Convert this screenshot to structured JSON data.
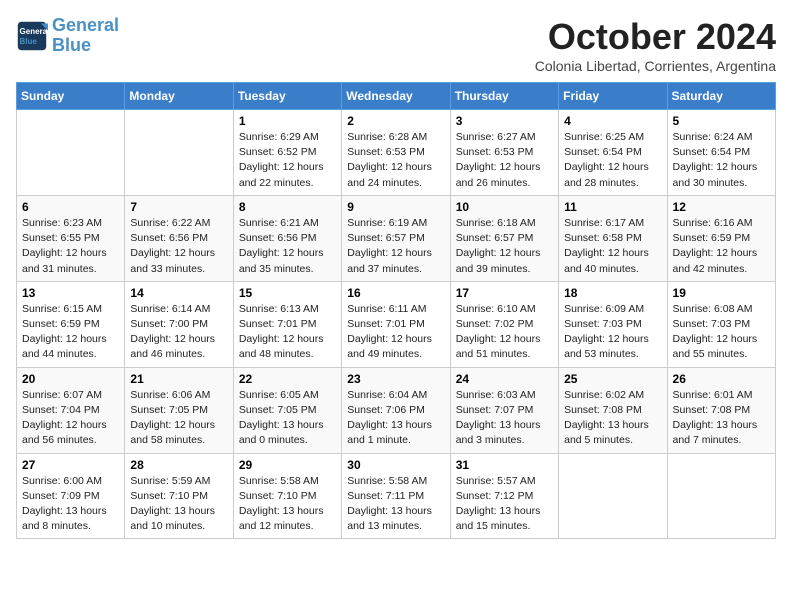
{
  "logo": {
    "line1": "General",
    "line2": "Blue"
  },
  "title": "October 2024",
  "subtitle": "Colonia Libertad, Corrientes, Argentina",
  "days_header": [
    "Sunday",
    "Monday",
    "Tuesday",
    "Wednesday",
    "Thursday",
    "Friday",
    "Saturday"
  ],
  "weeks": [
    [
      {
        "day": "",
        "info": ""
      },
      {
        "day": "",
        "info": ""
      },
      {
        "day": "1",
        "info": "Sunrise: 6:29 AM\nSunset: 6:52 PM\nDaylight: 12 hours\nand 22 minutes."
      },
      {
        "day": "2",
        "info": "Sunrise: 6:28 AM\nSunset: 6:53 PM\nDaylight: 12 hours\nand 24 minutes."
      },
      {
        "day": "3",
        "info": "Sunrise: 6:27 AM\nSunset: 6:53 PM\nDaylight: 12 hours\nand 26 minutes."
      },
      {
        "day": "4",
        "info": "Sunrise: 6:25 AM\nSunset: 6:54 PM\nDaylight: 12 hours\nand 28 minutes."
      },
      {
        "day": "5",
        "info": "Sunrise: 6:24 AM\nSunset: 6:54 PM\nDaylight: 12 hours\nand 30 minutes."
      }
    ],
    [
      {
        "day": "6",
        "info": "Sunrise: 6:23 AM\nSunset: 6:55 PM\nDaylight: 12 hours\nand 31 minutes."
      },
      {
        "day": "7",
        "info": "Sunrise: 6:22 AM\nSunset: 6:56 PM\nDaylight: 12 hours\nand 33 minutes."
      },
      {
        "day": "8",
        "info": "Sunrise: 6:21 AM\nSunset: 6:56 PM\nDaylight: 12 hours\nand 35 minutes."
      },
      {
        "day": "9",
        "info": "Sunrise: 6:19 AM\nSunset: 6:57 PM\nDaylight: 12 hours\nand 37 minutes."
      },
      {
        "day": "10",
        "info": "Sunrise: 6:18 AM\nSunset: 6:57 PM\nDaylight: 12 hours\nand 39 minutes."
      },
      {
        "day": "11",
        "info": "Sunrise: 6:17 AM\nSunset: 6:58 PM\nDaylight: 12 hours\nand 40 minutes."
      },
      {
        "day": "12",
        "info": "Sunrise: 6:16 AM\nSunset: 6:59 PM\nDaylight: 12 hours\nand 42 minutes."
      }
    ],
    [
      {
        "day": "13",
        "info": "Sunrise: 6:15 AM\nSunset: 6:59 PM\nDaylight: 12 hours\nand 44 minutes."
      },
      {
        "day": "14",
        "info": "Sunrise: 6:14 AM\nSunset: 7:00 PM\nDaylight: 12 hours\nand 46 minutes."
      },
      {
        "day": "15",
        "info": "Sunrise: 6:13 AM\nSunset: 7:01 PM\nDaylight: 12 hours\nand 48 minutes."
      },
      {
        "day": "16",
        "info": "Sunrise: 6:11 AM\nSunset: 7:01 PM\nDaylight: 12 hours\nand 49 minutes."
      },
      {
        "day": "17",
        "info": "Sunrise: 6:10 AM\nSunset: 7:02 PM\nDaylight: 12 hours\nand 51 minutes."
      },
      {
        "day": "18",
        "info": "Sunrise: 6:09 AM\nSunset: 7:03 PM\nDaylight: 12 hours\nand 53 minutes."
      },
      {
        "day": "19",
        "info": "Sunrise: 6:08 AM\nSunset: 7:03 PM\nDaylight: 12 hours\nand 55 minutes."
      }
    ],
    [
      {
        "day": "20",
        "info": "Sunrise: 6:07 AM\nSunset: 7:04 PM\nDaylight: 12 hours\nand 56 minutes."
      },
      {
        "day": "21",
        "info": "Sunrise: 6:06 AM\nSunset: 7:05 PM\nDaylight: 12 hours\nand 58 minutes."
      },
      {
        "day": "22",
        "info": "Sunrise: 6:05 AM\nSunset: 7:05 PM\nDaylight: 13 hours\nand 0 minutes."
      },
      {
        "day": "23",
        "info": "Sunrise: 6:04 AM\nSunset: 7:06 PM\nDaylight: 13 hours\nand 1 minute."
      },
      {
        "day": "24",
        "info": "Sunrise: 6:03 AM\nSunset: 7:07 PM\nDaylight: 13 hours\nand 3 minutes."
      },
      {
        "day": "25",
        "info": "Sunrise: 6:02 AM\nSunset: 7:08 PM\nDaylight: 13 hours\nand 5 minutes."
      },
      {
        "day": "26",
        "info": "Sunrise: 6:01 AM\nSunset: 7:08 PM\nDaylight: 13 hours\nand 7 minutes."
      }
    ],
    [
      {
        "day": "27",
        "info": "Sunrise: 6:00 AM\nSunset: 7:09 PM\nDaylight: 13 hours\nand 8 minutes."
      },
      {
        "day": "28",
        "info": "Sunrise: 5:59 AM\nSunset: 7:10 PM\nDaylight: 13 hours\nand 10 minutes."
      },
      {
        "day": "29",
        "info": "Sunrise: 5:58 AM\nSunset: 7:10 PM\nDaylight: 13 hours\nand 12 minutes."
      },
      {
        "day": "30",
        "info": "Sunrise: 5:58 AM\nSunset: 7:11 PM\nDaylight: 13 hours\nand 13 minutes."
      },
      {
        "day": "31",
        "info": "Sunrise: 5:57 AM\nSunset: 7:12 PM\nDaylight: 13 hours\nand 15 minutes."
      },
      {
        "day": "",
        "info": ""
      },
      {
        "day": "",
        "info": ""
      }
    ]
  ]
}
